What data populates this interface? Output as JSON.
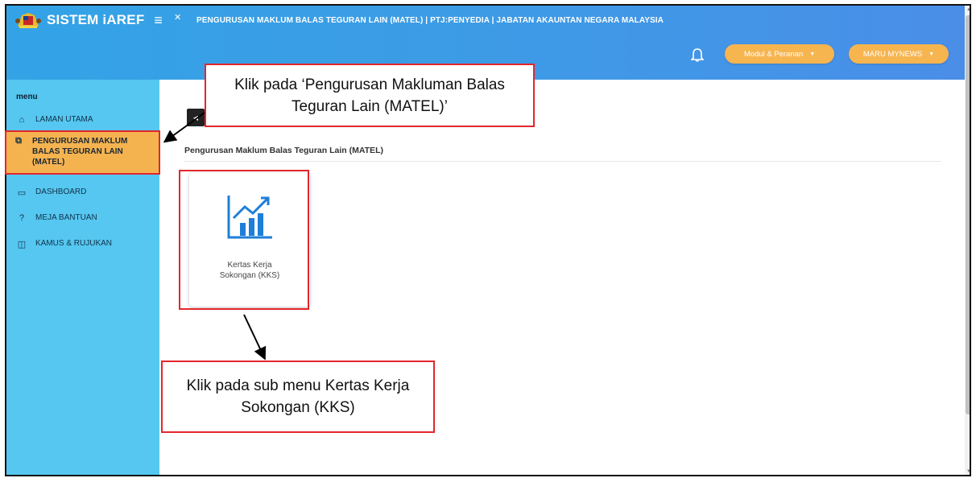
{
  "app": {
    "brand": "SISTEM iAREF",
    "page_heading": "PENGURUSAN MAKLUM BALAS TEGURAN LAIN (MATEL) | PTJ:PENYEDIA | JABATAN AKAUNTAN NEGARA MALAYSIA"
  },
  "topbar": {
    "modul_button": "Modul & Peranan",
    "user_button": "MARU MYNEWS"
  },
  "sidebar": {
    "title": "menu",
    "items": [
      {
        "label": "LAMAN UTAMA",
        "icon": "home-icon"
      },
      {
        "label": "PENGURUSAN MAKLUM BALAS TEGURAN LAIN (MATEL)",
        "icon": "folder-icon",
        "active": true
      },
      {
        "label": "DASHBOARD",
        "icon": "dashboard-icon"
      },
      {
        "label": "MEJA BANTUAN",
        "icon": "help-icon"
      },
      {
        "label": "KAMUS & RUJUKAN",
        "icon": "book-icon"
      }
    ]
  },
  "main": {
    "breadcrumb": "Pengurusan Maklum Balas Teguran Lain (MATEL)",
    "card": {
      "label": "Kertas Kerja Sokongan (KKS)",
      "icon": "chart-growth-icon"
    }
  },
  "annotations": {
    "callout_1": "Klik pada ‘Pengurusan Makluman Balas Teguran Lain (MATEL)’",
    "callout_2": "Klik pada sub menu Kertas Kerja Sokongan (KKS)"
  },
  "colors": {
    "topbar": "#3e9ae6",
    "sidebar": "#55c7f0",
    "accent": "#f5b350",
    "highlight": "#e3262c",
    "icon_blue": "#1e7fd8"
  }
}
